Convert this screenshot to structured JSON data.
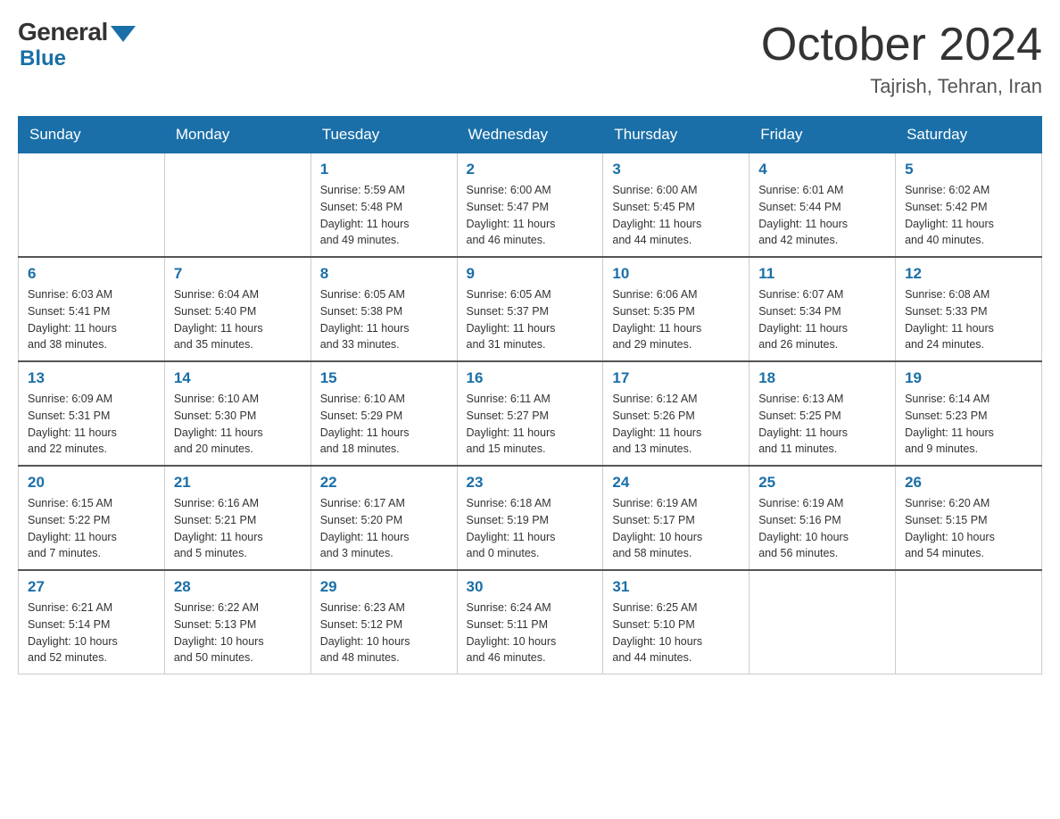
{
  "logo": {
    "general": "General",
    "blue": "Blue"
  },
  "title": "October 2024",
  "location": "Tajrish, Tehran, Iran",
  "weekdays": [
    "Sunday",
    "Monday",
    "Tuesday",
    "Wednesday",
    "Thursday",
    "Friday",
    "Saturday"
  ],
  "weeks": [
    [
      {
        "day": "",
        "info": ""
      },
      {
        "day": "",
        "info": ""
      },
      {
        "day": "1",
        "info": "Sunrise: 5:59 AM\nSunset: 5:48 PM\nDaylight: 11 hours\nand 49 minutes."
      },
      {
        "day": "2",
        "info": "Sunrise: 6:00 AM\nSunset: 5:47 PM\nDaylight: 11 hours\nand 46 minutes."
      },
      {
        "day": "3",
        "info": "Sunrise: 6:00 AM\nSunset: 5:45 PM\nDaylight: 11 hours\nand 44 minutes."
      },
      {
        "day": "4",
        "info": "Sunrise: 6:01 AM\nSunset: 5:44 PM\nDaylight: 11 hours\nand 42 minutes."
      },
      {
        "day": "5",
        "info": "Sunrise: 6:02 AM\nSunset: 5:42 PM\nDaylight: 11 hours\nand 40 minutes."
      }
    ],
    [
      {
        "day": "6",
        "info": "Sunrise: 6:03 AM\nSunset: 5:41 PM\nDaylight: 11 hours\nand 38 minutes."
      },
      {
        "day": "7",
        "info": "Sunrise: 6:04 AM\nSunset: 5:40 PM\nDaylight: 11 hours\nand 35 minutes."
      },
      {
        "day": "8",
        "info": "Sunrise: 6:05 AM\nSunset: 5:38 PM\nDaylight: 11 hours\nand 33 minutes."
      },
      {
        "day": "9",
        "info": "Sunrise: 6:05 AM\nSunset: 5:37 PM\nDaylight: 11 hours\nand 31 minutes."
      },
      {
        "day": "10",
        "info": "Sunrise: 6:06 AM\nSunset: 5:35 PM\nDaylight: 11 hours\nand 29 minutes."
      },
      {
        "day": "11",
        "info": "Sunrise: 6:07 AM\nSunset: 5:34 PM\nDaylight: 11 hours\nand 26 minutes."
      },
      {
        "day": "12",
        "info": "Sunrise: 6:08 AM\nSunset: 5:33 PM\nDaylight: 11 hours\nand 24 minutes."
      }
    ],
    [
      {
        "day": "13",
        "info": "Sunrise: 6:09 AM\nSunset: 5:31 PM\nDaylight: 11 hours\nand 22 minutes."
      },
      {
        "day": "14",
        "info": "Sunrise: 6:10 AM\nSunset: 5:30 PM\nDaylight: 11 hours\nand 20 minutes."
      },
      {
        "day": "15",
        "info": "Sunrise: 6:10 AM\nSunset: 5:29 PM\nDaylight: 11 hours\nand 18 minutes."
      },
      {
        "day": "16",
        "info": "Sunrise: 6:11 AM\nSunset: 5:27 PM\nDaylight: 11 hours\nand 15 minutes."
      },
      {
        "day": "17",
        "info": "Sunrise: 6:12 AM\nSunset: 5:26 PM\nDaylight: 11 hours\nand 13 minutes."
      },
      {
        "day": "18",
        "info": "Sunrise: 6:13 AM\nSunset: 5:25 PM\nDaylight: 11 hours\nand 11 minutes."
      },
      {
        "day": "19",
        "info": "Sunrise: 6:14 AM\nSunset: 5:23 PM\nDaylight: 11 hours\nand 9 minutes."
      }
    ],
    [
      {
        "day": "20",
        "info": "Sunrise: 6:15 AM\nSunset: 5:22 PM\nDaylight: 11 hours\nand 7 minutes."
      },
      {
        "day": "21",
        "info": "Sunrise: 6:16 AM\nSunset: 5:21 PM\nDaylight: 11 hours\nand 5 minutes."
      },
      {
        "day": "22",
        "info": "Sunrise: 6:17 AM\nSunset: 5:20 PM\nDaylight: 11 hours\nand 3 minutes."
      },
      {
        "day": "23",
        "info": "Sunrise: 6:18 AM\nSunset: 5:19 PM\nDaylight: 11 hours\nand 0 minutes."
      },
      {
        "day": "24",
        "info": "Sunrise: 6:19 AM\nSunset: 5:17 PM\nDaylight: 10 hours\nand 58 minutes."
      },
      {
        "day": "25",
        "info": "Sunrise: 6:19 AM\nSunset: 5:16 PM\nDaylight: 10 hours\nand 56 minutes."
      },
      {
        "day": "26",
        "info": "Sunrise: 6:20 AM\nSunset: 5:15 PM\nDaylight: 10 hours\nand 54 minutes."
      }
    ],
    [
      {
        "day": "27",
        "info": "Sunrise: 6:21 AM\nSunset: 5:14 PM\nDaylight: 10 hours\nand 52 minutes."
      },
      {
        "day": "28",
        "info": "Sunrise: 6:22 AM\nSunset: 5:13 PM\nDaylight: 10 hours\nand 50 minutes."
      },
      {
        "day": "29",
        "info": "Sunrise: 6:23 AM\nSunset: 5:12 PM\nDaylight: 10 hours\nand 48 minutes."
      },
      {
        "day": "30",
        "info": "Sunrise: 6:24 AM\nSunset: 5:11 PM\nDaylight: 10 hours\nand 46 minutes."
      },
      {
        "day": "31",
        "info": "Sunrise: 6:25 AM\nSunset: 5:10 PM\nDaylight: 10 hours\nand 44 minutes."
      },
      {
        "day": "",
        "info": ""
      },
      {
        "day": "",
        "info": ""
      }
    ]
  ]
}
